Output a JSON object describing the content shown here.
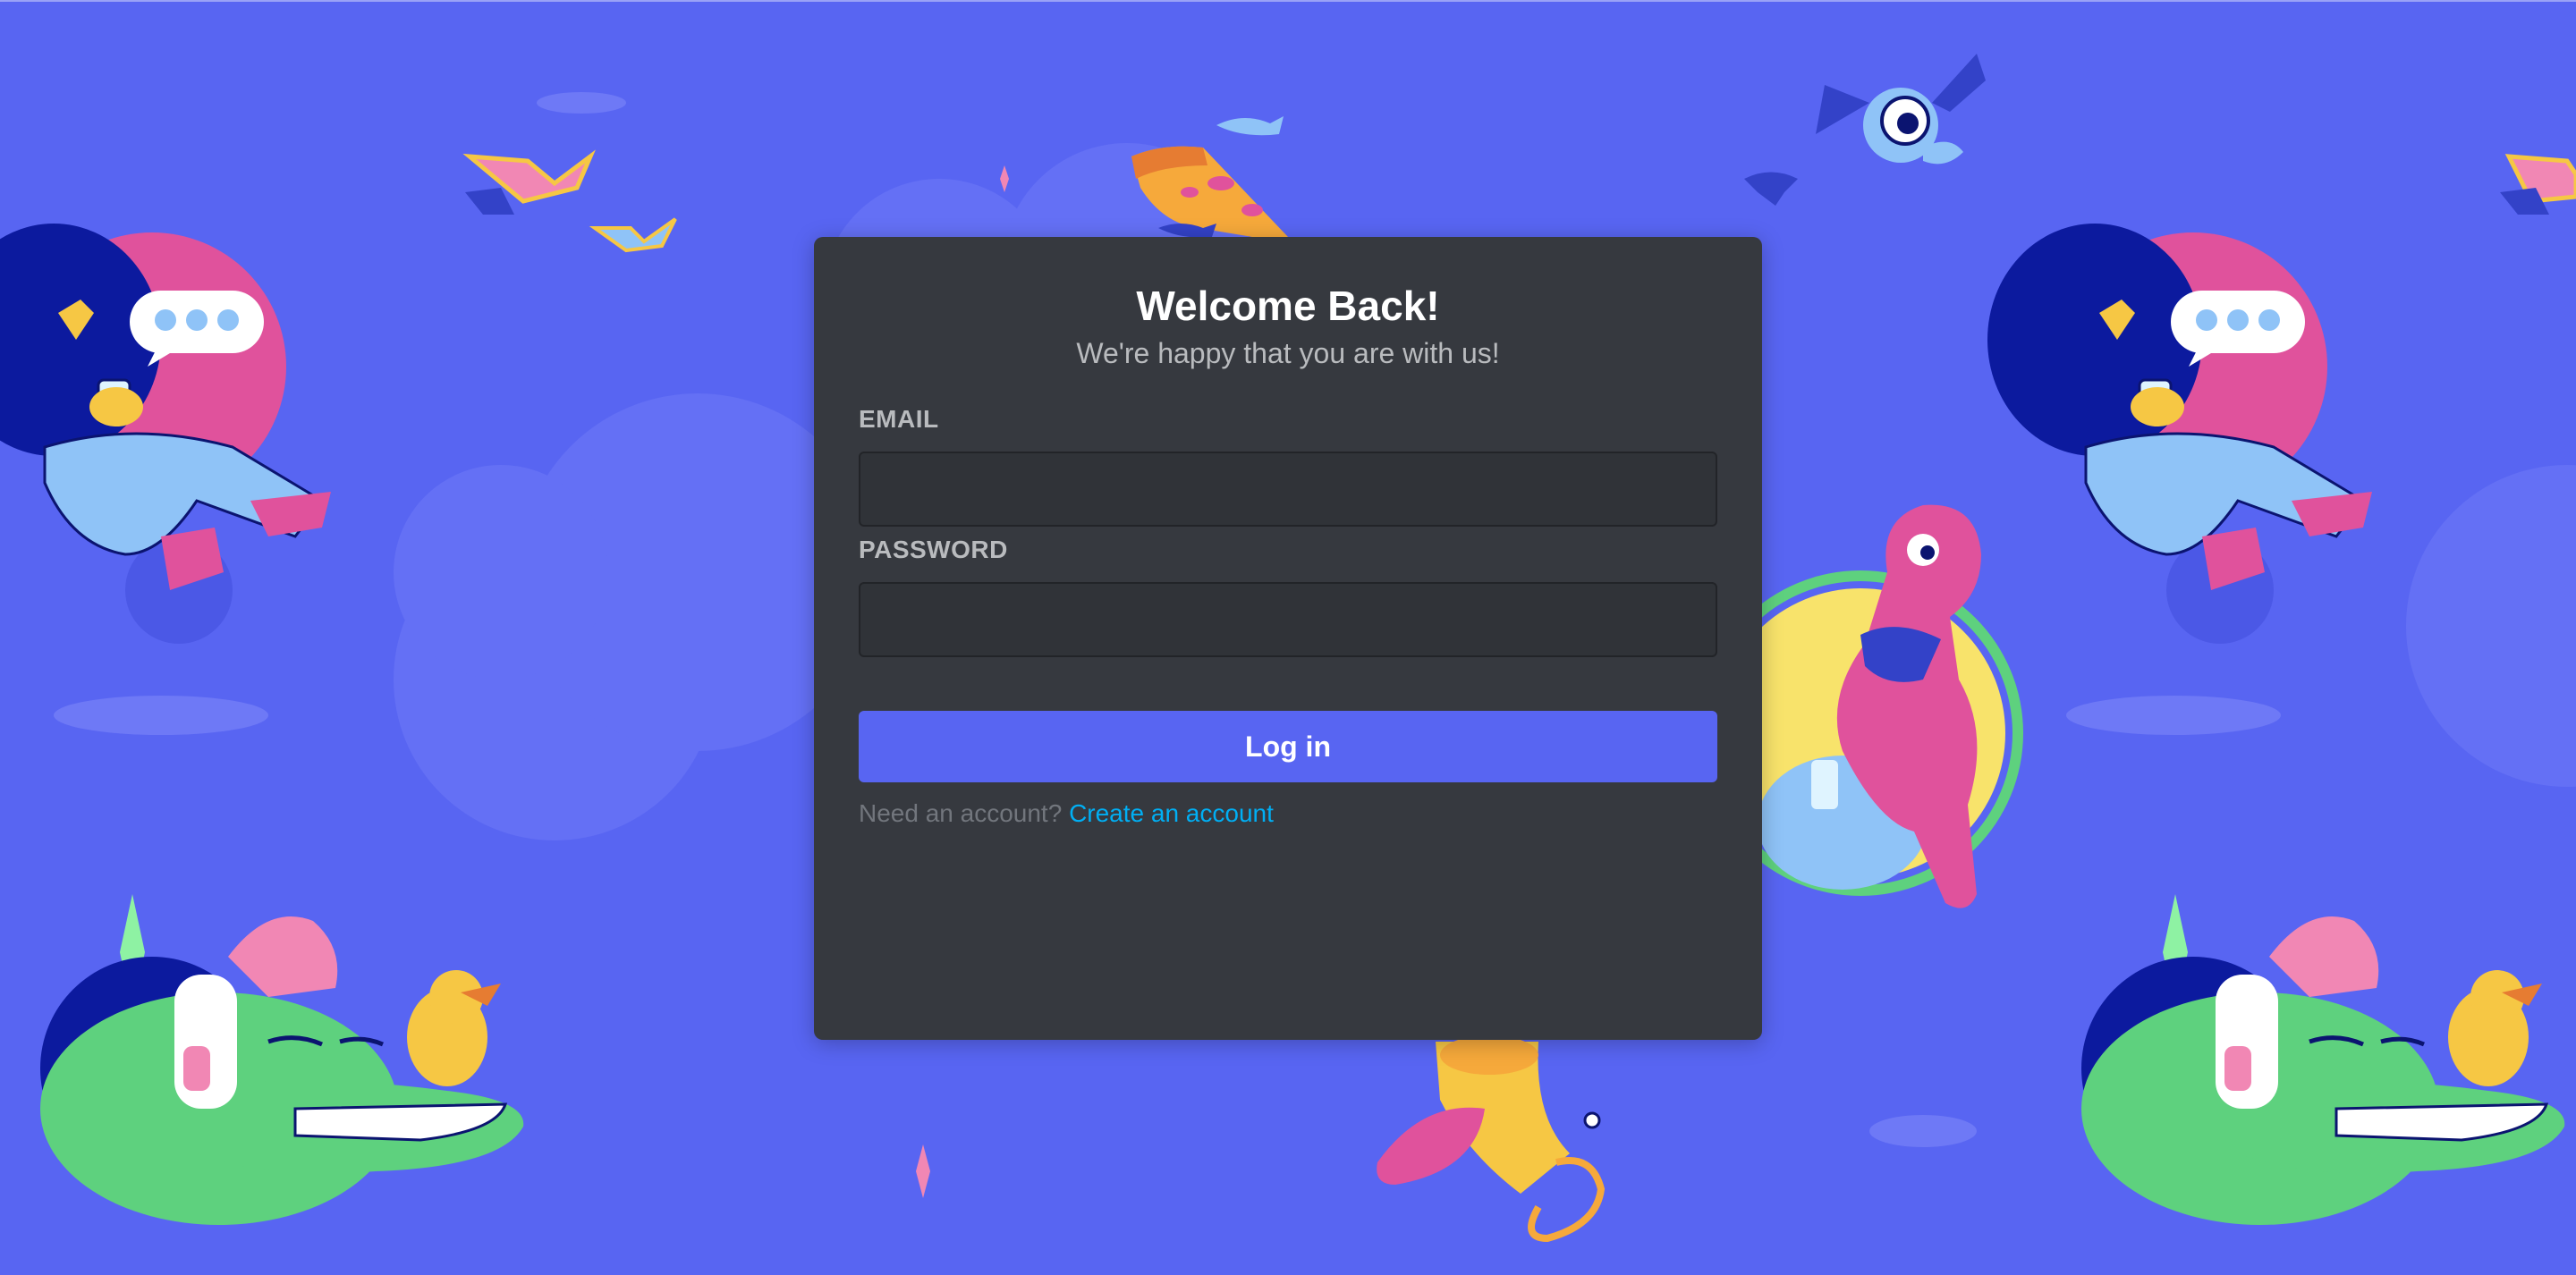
{
  "login": {
    "title": "Welcome Back!",
    "subtitle": "We're happy that you are with us!",
    "email_label": "EMAIL",
    "email_value": "",
    "password_label": "PASSWORD",
    "password_value": "",
    "login_button": "Log in",
    "register_prompt": "Need an account?",
    "register_link": "Create an account"
  },
  "colors": {
    "background": "#5865F2",
    "card": "#36393f",
    "accent": "#5865F2",
    "link": "#00aff4"
  },
  "illustrations": [
    "reading-character-illustration",
    "green-monster-illustration",
    "pink-monster-illustration",
    "pizza-illustration",
    "bat-illustration",
    "book-birds-illustration",
    "trumpet-illustration"
  ]
}
